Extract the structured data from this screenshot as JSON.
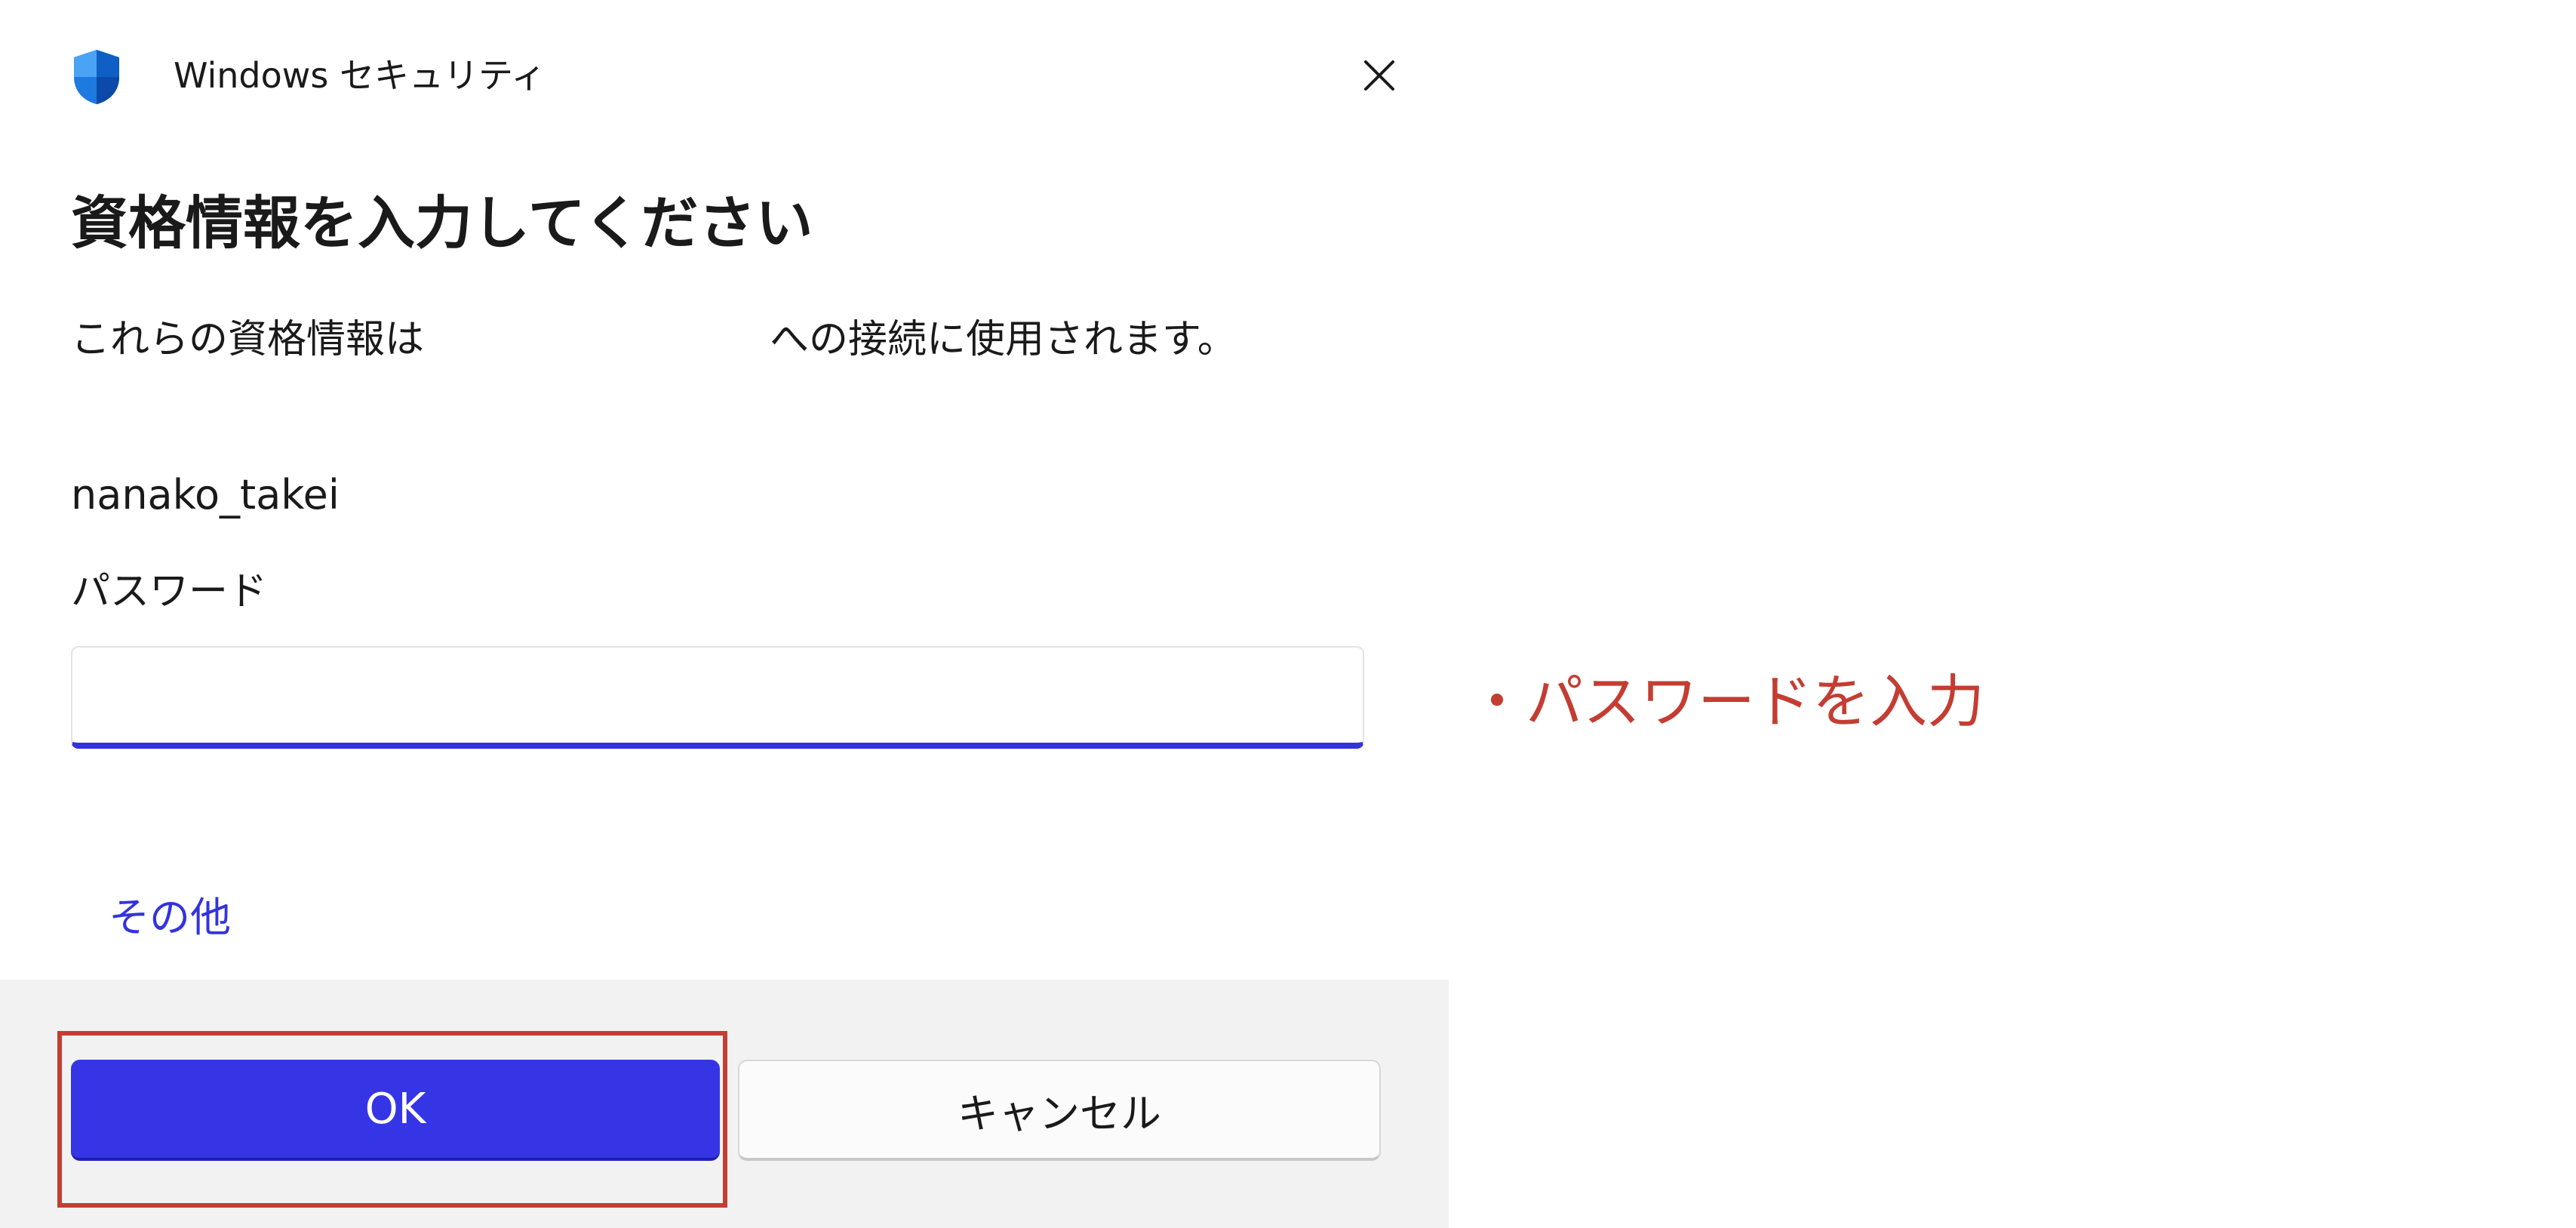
{
  "dialog": {
    "app_title": "Windows セキュリティ",
    "heading": "資格情報を入力してください",
    "description_before": "これらの資格情報は",
    "description_after": "への接続に使用されます。",
    "username": "nanako_takei",
    "password_label": "パスワード",
    "password_value": "",
    "other_link": "その他",
    "ok_label": "OK",
    "cancel_label": "キャンセル",
    "icons": {
      "app": "shield-icon",
      "close": "close-icon"
    }
  },
  "annotation": {
    "text": "・パスワードを入力"
  },
  "colors": {
    "accent": "#3535e6",
    "annotation_red": "#c43d32",
    "footer_bg": "#f2f2f2",
    "link": "#3333dd"
  }
}
